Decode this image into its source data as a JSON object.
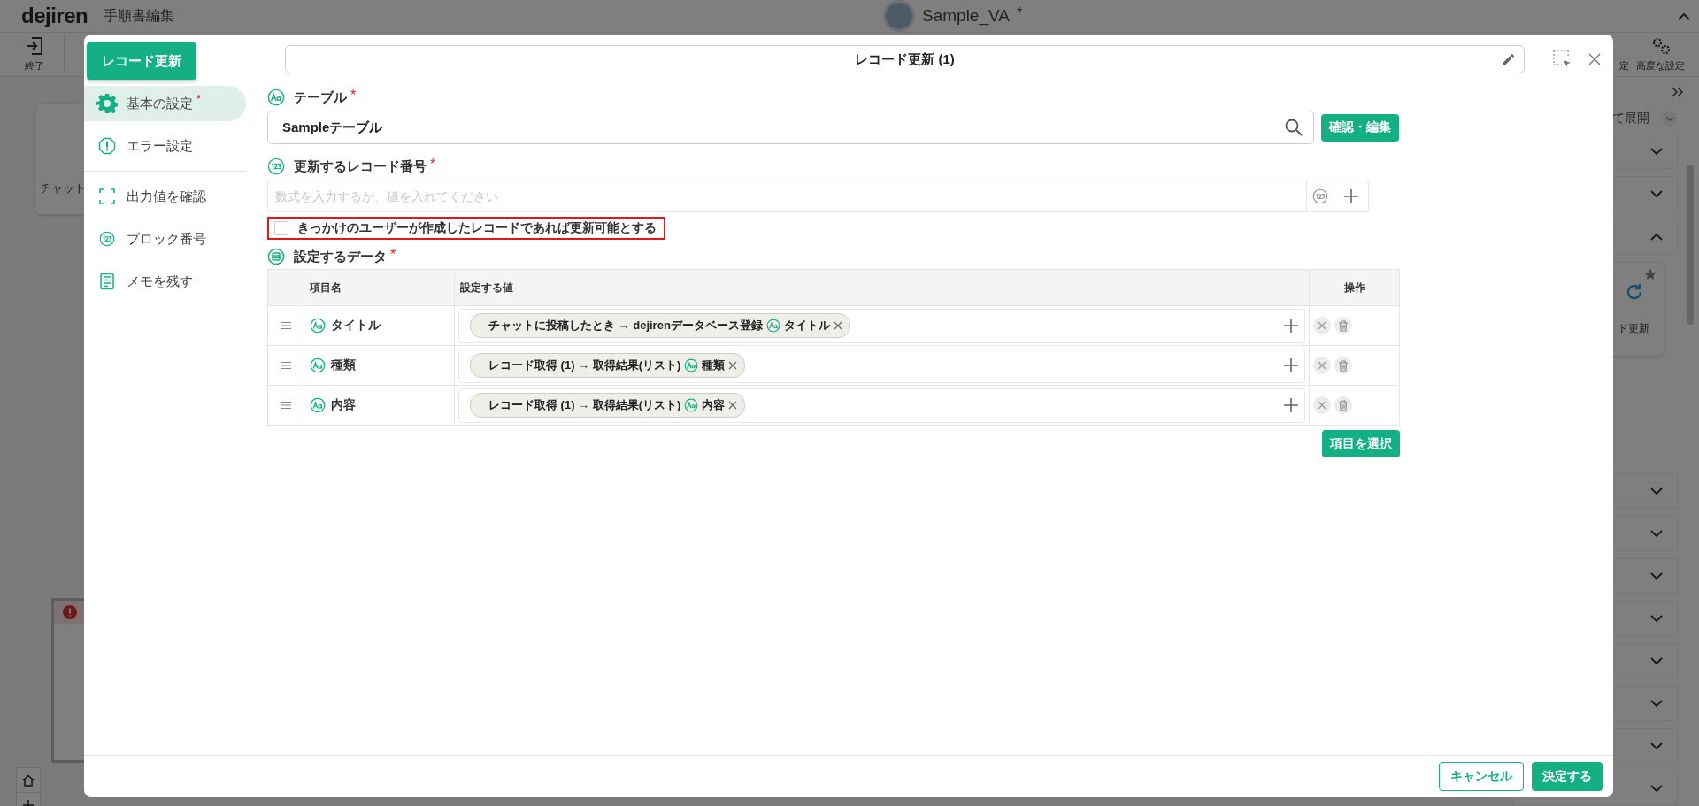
{
  "background": {
    "logo": "dejiren",
    "page_title": "手順書編集",
    "bot_name": "Sample_VA",
    "unsaved_mark": "*",
    "toolbar_left": [
      {
        "label": "終了"
      }
    ],
    "toolbar_right": [
      {
        "label": "定"
      },
      {
        "label": "高度な設定"
      }
    ],
    "canvas_card_label": "チャット",
    "panel": {
      "expand_label": "て展開",
      "sections": [
        {
          "expanded": false
        },
        {
          "expanded": false
        },
        {
          "expanded": true,
          "block_label": "ド更新"
        },
        {
          "expanded": false
        },
        {
          "expanded": false
        },
        {
          "expanded": false
        },
        {
          "expanded": false
        },
        {
          "expanded": false
        },
        {
          "expanded": false
        },
        {
          "expanded": false
        },
        {
          "expanded": false
        }
      ]
    }
  },
  "dialog": {
    "block_type": "レコード更新",
    "title": "レコード更新 (1)",
    "sidebar": [
      [
        {
          "label": "基本の設定",
          "required": true,
          "selected": true
        },
        {
          "label": "エラー設定",
          "required": false,
          "selected": false
        }
      ],
      [
        {
          "label": "出力値を確認",
          "required": false,
          "selected": false
        },
        {
          "label": "ブロック番号",
          "required": false,
          "selected": false
        },
        {
          "label": "メモを残す",
          "required": false,
          "selected": false
        }
      ]
    ],
    "table_field": {
      "label": "テーブル",
      "required": true,
      "value": "Sampleテーブル",
      "button": "確認・編集"
    },
    "record_field": {
      "label": "更新するレコード番号",
      "required": true,
      "placeholder": "数式を入力するか、値を入れてください"
    },
    "checkbox": {
      "label": "きっかけのユーザーが作成したレコードであれば更新可能とする",
      "checked": false,
      "highlighted": true
    },
    "data_table": {
      "label": "設定するデータ",
      "required": true,
      "columns": [
        "項目名",
        "設定する値",
        "操作"
      ],
      "rows": [
        {
          "name": "タイトル",
          "chips": [
            {
              "source": "チャットに投稿したとき → dejirenデータベース登録",
              "field": "タイトル"
            }
          ]
        },
        {
          "name": "種類",
          "chips": [
            {
              "source": "レコード取得 (1) → 取得結果(リスト)",
              "field": "種類"
            }
          ]
        },
        {
          "name": "内容",
          "chips": [
            {
              "source": "レコード取得 (1) → 取得結果(リスト)",
              "field": "内容"
            }
          ]
        }
      ],
      "button": "項目を選択"
    },
    "footer": {
      "cancel": "キャンセル",
      "confirm": "決定する"
    }
  }
}
